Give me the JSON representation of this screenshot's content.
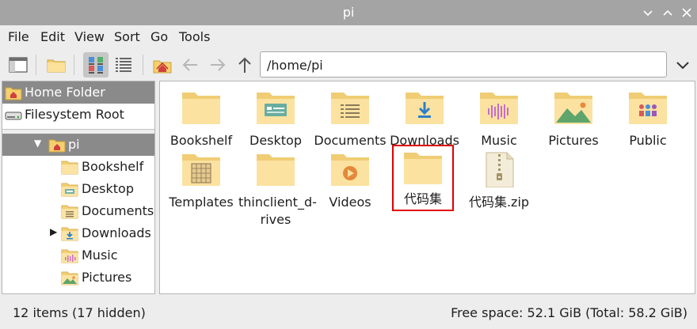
{
  "window": {
    "title": "pi"
  },
  "menubar": {
    "items": [
      "File",
      "Edit",
      "View",
      "Sort",
      "Go",
      "Tools"
    ]
  },
  "toolbar": {
    "path": "/home/pi"
  },
  "sidebar": {
    "places": [
      {
        "label": "Home Folder",
        "icon": "home-icon",
        "selected": true
      },
      {
        "label": "Filesystem Root",
        "icon": "drive-icon",
        "selected": false
      }
    ],
    "tree": [
      {
        "label": "pi",
        "icon": "home-icon",
        "expander": "▼",
        "selected": true
      },
      {
        "label": "Bookshelf",
        "icon": "folder-icon"
      },
      {
        "label": "Desktop",
        "icon": "desktop-folder-icon"
      },
      {
        "label": "Documents",
        "icon": "documents-folder-icon"
      },
      {
        "label": "Downloads",
        "icon": "downloads-folder-icon",
        "expander": "▶"
      },
      {
        "label": "Music",
        "icon": "music-folder-icon"
      },
      {
        "label": "Pictures",
        "icon": "pictures-folder-icon"
      }
    ]
  },
  "files": [
    {
      "name": "Bookshelf",
      "icon": "folder-icon"
    },
    {
      "name": "Desktop",
      "icon": "desktop-folder-icon"
    },
    {
      "name": "Documents",
      "icon": "documents-folder-icon"
    },
    {
      "name": "Downloads",
      "icon": "downloads-folder-icon"
    },
    {
      "name": "Music",
      "icon": "music-folder-icon"
    },
    {
      "name": "Pictures",
      "icon": "pictures-folder-icon"
    },
    {
      "name": "Public",
      "icon": "public-folder-icon"
    },
    {
      "name": "Templates",
      "icon": "templates-folder-icon"
    },
    {
      "name": "thinclient_d-\nrives",
      "icon": "folder-icon"
    },
    {
      "name": "Videos",
      "icon": "videos-folder-icon"
    },
    {
      "name": "代码集",
      "icon": "folder-icon",
      "highlighted": true
    },
    {
      "name": "代码集.zip",
      "icon": "zip-archive-icon"
    }
  ],
  "statusbar": {
    "items_count": "12 items (17 hidden)",
    "free_space": "Free space: 52.1 GiB (Total: 58.2 GiB)"
  },
  "colors": {
    "folder": "#f8dc8c",
    "folder_dark": "#e9c46a",
    "highlight_box": "#e00000",
    "selection": "#8a8a8a"
  }
}
